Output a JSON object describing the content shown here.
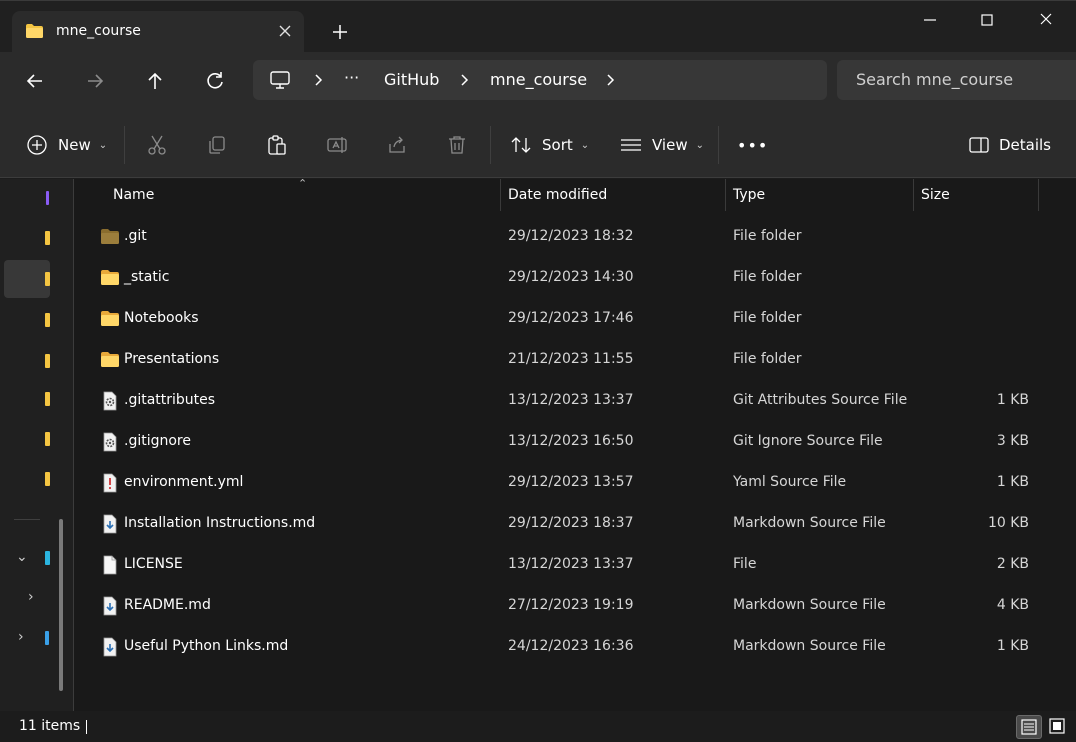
{
  "window": {
    "tab_title": "mne_course",
    "tab_icon": "folder-icon",
    "accent_folder": "#f4c542"
  },
  "navigation": {
    "breadcrumb": [
      "GitHub",
      "mne_course"
    ],
    "overflow_label": "···",
    "search_placeholder": "Search mne_course"
  },
  "commandbar": {
    "new_label": "New",
    "sort_label": "Sort",
    "view_label": "View",
    "more_label": "•••",
    "details_label": "Details"
  },
  "columns": {
    "name": "Name",
    "date": "Date modified",
    "type": "Type",
    "size": "Size"
  },
  "files": [
    {
      "name": ".git",
      "date": "29/12/2023 18:32",
      "type": "File folder",
      "size": "",
      "icon": "folder-dim-icon"
    },
    {
      "name": "_static",
      "date": "29/12/2023 14:30",
      "type": "File folder",
      "size": "",
      "icon": "folder-icon"
    },
    {
      "name": "Notebooks",
      "date": "29/12/2023 17:46",
      "type": "File folder",
      "size": "",
      "icon": "folder-icon"
    },
    {
      "name": "Presentations",
      "date": "21/12/2023 11:55",
      "type": "File folder",
      "size": "",
      "icon": "folder-icon"
    },
    {
      "name": ".gitattributes",
      "date": "13/12/2023 13:37",
      "type": "Git Attributes Source File",
      "size": "1 KB",
      "icon": "settings-file-icon"
    },
    {
      "name": ".gitignore",
      "date": "13/12/2023 16:50",
      "type": "Git Ignore Source File",
      "size": "3 KB",
      "icon": "settings-file-icon"
    },
    {
      "name": "environment.yml",
      "date": "29/12/2023 13:57",
      "type": "Yaml Source File",
      "size": "1 KB",
      "icon": "yaml-file-icon"
    },
    {
      "name": "Installation Instructions.md",
      "date": "29/12/2023 18:37",
      "type": "Markdown Source File",
      "size": "10 KB",
      "icon": "markdown-file-icon"
    },
    {
      "name": "LICENSE",
      "date": "13/12/2023 13:37",
      "type": "File",
      "size": "2 KB",
      "icon": "blank-file-icon"
    },
    {
      "name": "README.md",
      "date": "27/12/2023 19:19",
      "type": "Markdown Source File",
      "size": "4 KB",
      "icon": "markdown-file-icon"
    },
    {
      "name": "Useful Python Links.md",
      "date": "24/12/2023 16:36",
      "type": "Markdown Source File",
      "size": "1 KB",
      "icon": "markdown-file-icon"
    }
  ],
  "status": {
    "item_count": "11 items"
  }
}
